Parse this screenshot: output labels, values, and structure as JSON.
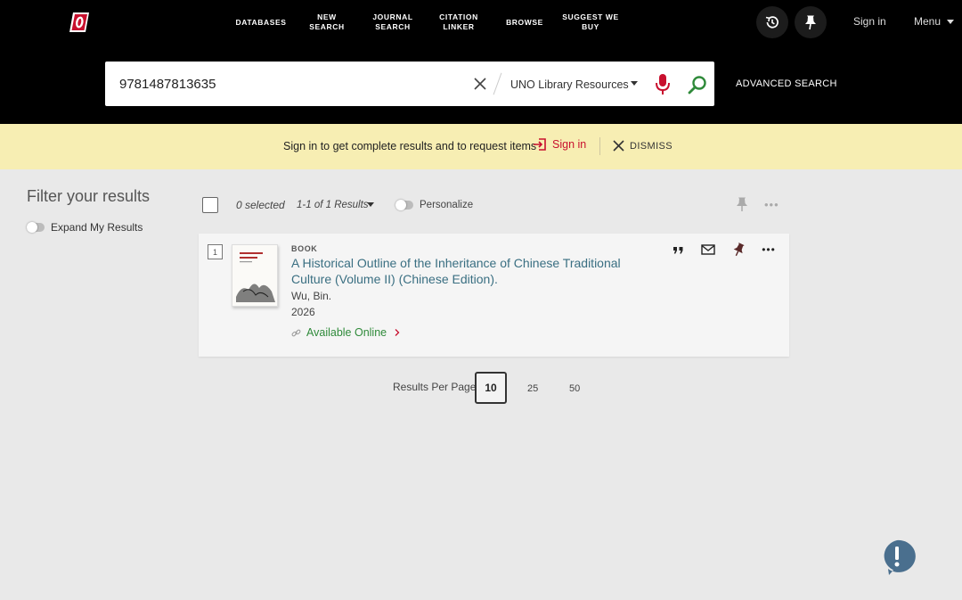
{
  "nav": {
    "items": [
      "DATABASES",
      "NEW SEARCH",
      "JOURNAL SEARCH",
      "CITATION LINKER",
      "BROWSE",
      "SUGGEST WE BUY"
    ],
    "sign_in": "Sign in",
    "menu": "Menu"
  },
  "search": {
    "query": "9781487813635",
    "scope": "UNO Library Resources",
    "advanced": "ADVANCED SEARCH"
  },
  "banner": {
    "message": "Sign in to get complete results and to request items",
    "sign_in": "Sign in",
    "dismiss": "DISMISS"
  },
  "filter": {
    "title": "Filter your results",
    "expand_label": "Expand My Results"
  },
  "results_header": {
    "selected": "0 selected",
    "count": "1-1 of 1 Results",
    "personalize": "Personalize"
  },
  "results": [
    {
      "rank": "1",
      "type": "BOOK",
      "title": "A Historical Outline of the Inheritance of Chinese Traditional Culture (Volume II) (Chinese Edition).",
      "author": "Wu, Bin.",
      "year": "2026",
      "availability": "Available Online"
    }
  ],
  "pagination": {
    "label": "Results Per Page",
    "options": [
      "10",
      "25",
      "50"
    ],
    "selected": "10"
  },
  "colors": {
    "accent_red": "#c8102e",
    "link_teal": "#3a6f82",
    "available_green": "#2f8a3a",
    "banner_yellow": "#f7eeb3"
  },
  "icons": [
    "uno-logo",
    "history-icon",
    "pin-icon",
    "clear-icon",
    "caret-down-icon",
    "microphone-icon",
    "search-icon",
    "sign-in-icon",
    "close-icon",
    "quote-icon",
    "email-icon",
    "more-icon",
    "link-icon",
    "chevron-right-icon",
    "feedback-icon"
  ]
}
